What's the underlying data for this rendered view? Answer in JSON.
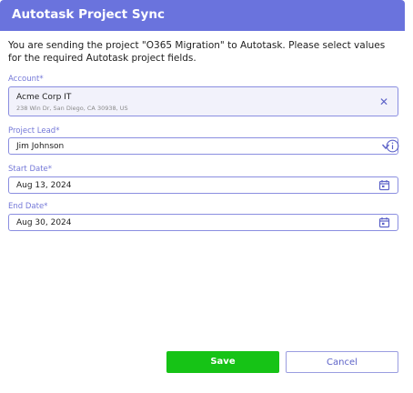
{
  "header": {
    "title": "Autotask Project Sync"
  },
  "intro": "You are sending the project \"O365 Migration\" to Autotask. Please select values for the required Autotask project fields.",
  "fields": {
    "account": {
      "label": "Account*",
      "value": "Acme Corp IT",
      "address": "238 Win Dr, San Diego, CA 30938, US"
    },
    "project_lead": {
      "label": "Project Lead*",
      "value": "Jim  Johnson"
    },
    "start_date": {
      "label": "Start Date*",
      "value": "Aug 13, 2024"
    },
    "end_date": {
      "label": "End Date*",
      "value": "Aug 30, 2024"
    }
  },
  "buttons": {
    "save": "Save",
    "cancel": "Cancel"
  },
  "icons": {
    "clear": "close-icon",
    "dropdown": "chevron-down-icon",
    "info": "info-icon",
    "calendar": "calendar-icon"
  },
  "colors": {
    "header": "#6a73dd",
    "accent": "#7478d8",
    "save": "#16c316"
  }
}
